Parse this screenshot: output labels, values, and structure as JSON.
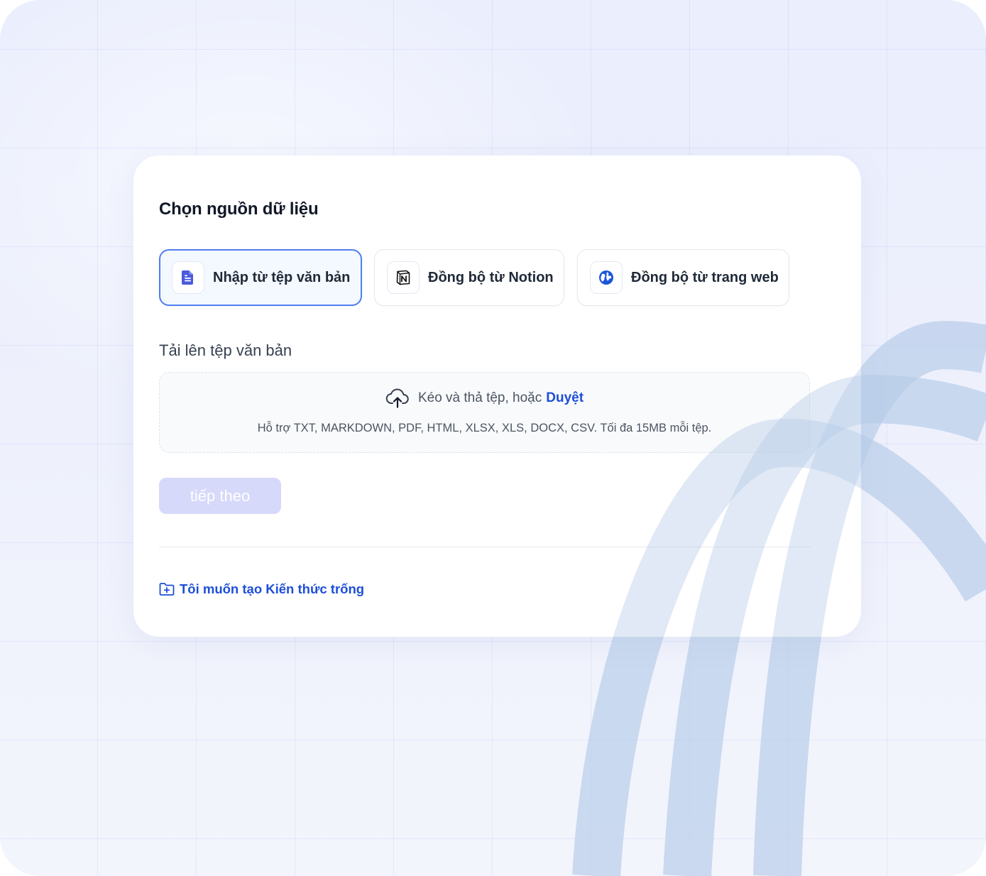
{
  "page": {
    "title": "Chọn nguồn dữ liệu"
  },
  "data_sources": {
    "options": [
      {
        "label": "Nhập từ tệp văn bản",
        "icon": "file-text-icon",
        "selected": true
      },
      {
        "label": "Đồng bộ từ Notion",
        "icon": "notion-icon",
        "selected": false
      },
      {
        "label": "Đồng bộ từ trang web",
        "icon": "globe-icon",
        "selected": false
      }
    ]
  },
  "upload": {
    "title": "Tải lên tệp văn bản",
    "drop_text": "Kéo và thả tệp, hoặc",
    "browse_label": "Duyệt",
    "hint": "Hỗ trợ TXT, MARKDOWN, PDF, HTML, XLSX, XLS, DOCX, CSV. Tối đa 15MB mỗi tệp.",
    "icon": "upload-cloud-icon"
  },
  "actions": {
    "next_label": "tiếp theo",
    "next_disabled": true,
    "create_empty_label": "Tôi muốn tạo Kiến thức trống",
    "create_empty_icon": "folder-plus-icon"
  },
  "colors": {
    "accent": "#1d4ed8",
    "selected_border": "#4f7ff0",
    "button_disabled": "#d6d9fa",
    "background": "#eceffd",
    "decor_arcs": "#c2d6ec"
  }
}
